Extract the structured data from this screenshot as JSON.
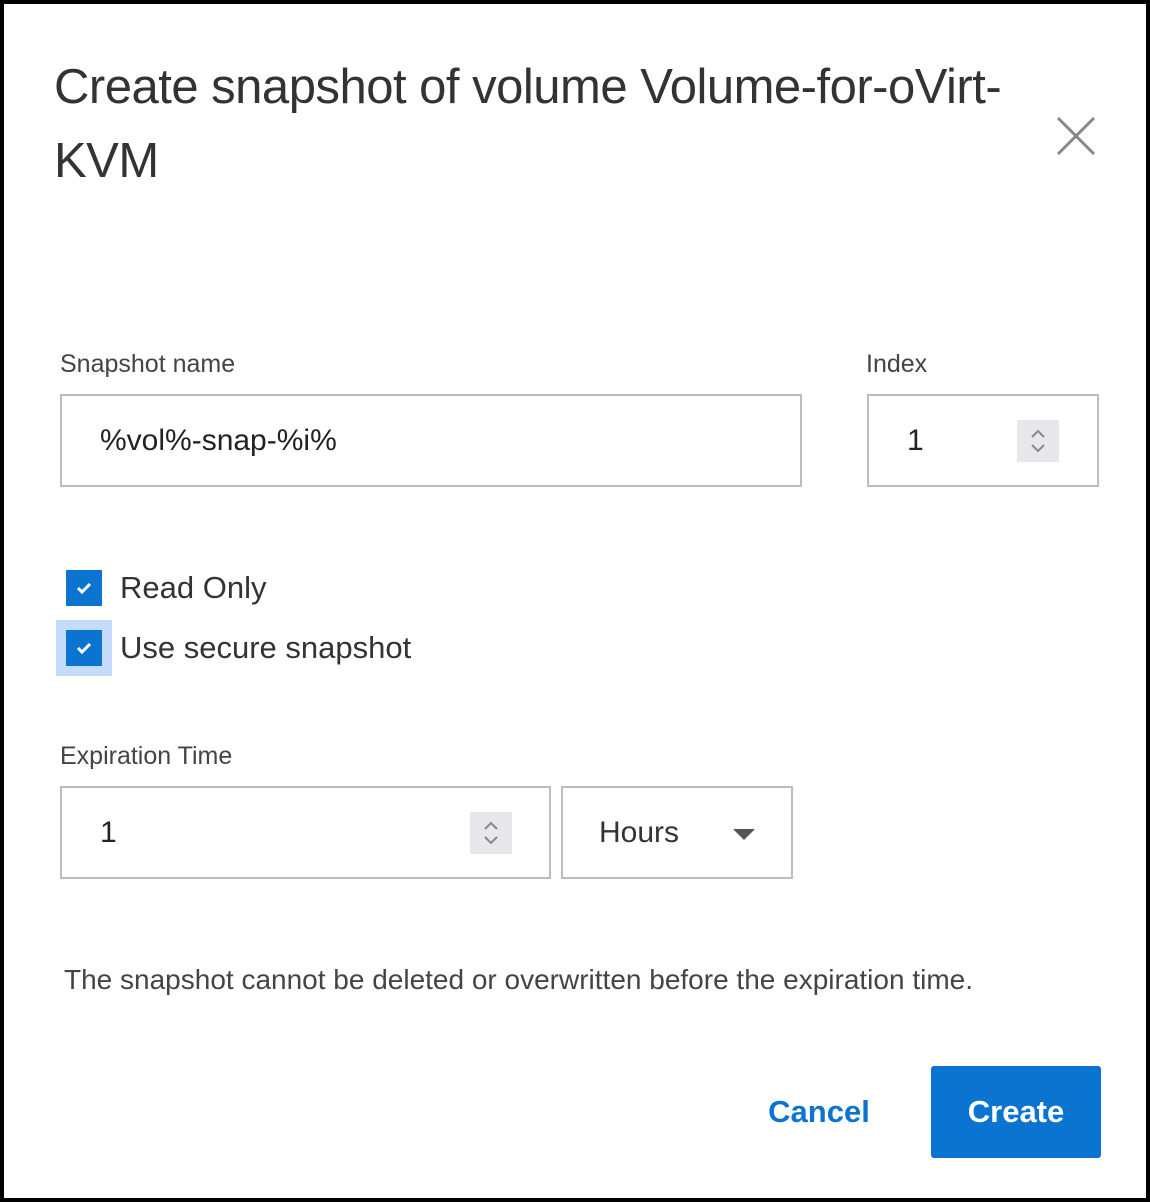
{
  "dialog": {
    "title": "Create snapshot of volume Volume-for-oVirt-KVM",
    "close_icon": "close-icon"
  },
  "form": {
    "snapshot_name": {
      "label": "Snapshot name",
      "value": "%vol%-snap-%i%"
    },
    "index": {
      "label": "Index",
      "value": "1"
    },
    "read_only": {
      "label": "Read Only",
      "checked": true
    },
    "secure_snapshot": {
      "label": "Use secure snapshot",
      "checked": true
    },
    "expiration": {
      "label": "Expiration Time",
      "value": "1",
      "unit": "Hours"
    },
    "note": "The snapshot cannot be deleted or overwritten before the expiration time."
  },
  "buttons": {
    "cancel": "Cancel",
    "create": "Create"
  },
  "colors": {
    "accent": "#0a74d0",
    "focus_ring": "#c5dcfb"
  }
}
